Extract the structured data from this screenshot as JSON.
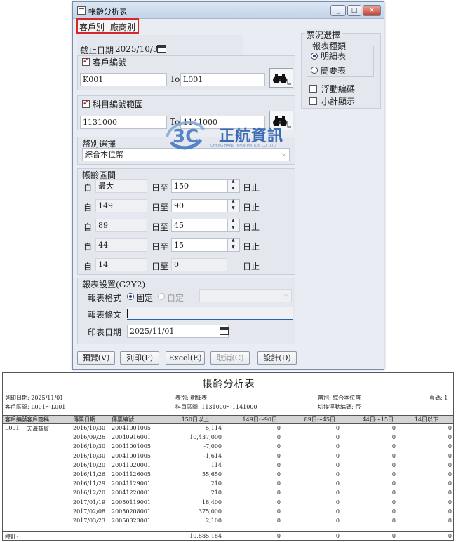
{
  "window": {
    "title": "帳齡分析表",
    "min": "_",
    "max": "□",
    "close": "×"
  },
  "tabs": [
    "客戶別",
    "廠商別"
  ],
  "cutoff": {
    "label": "截止日期",
    "value": "2025/10/31"
  },
  "customer": {
    "label": "客戶編號",
    "from": "K001",
    "to_label": "To",
    "to": "L001"
  },
  "account": {
    "label": "科目編號範圍",
    "from": "1131000",
    "to_label": "To",
    "to": "1141000"
  },
  "currency": {
    "label": "幣別選擇",
    "value": "綜合本位幣"
  },
  "aging": {
    "label": "帳齡區間",
    "prefix": "自",
    "mid": "日至",
    "suffix": "日止",
    "rows": [
      {
        "from": "最大",
        "to": "150"
      },
      {
        "from": "149",
        "to": "90"
      },
      {
        "from": "89",
        "to": "45"
      },
      {
        "from": "44",
        "to": "15"
      },
      {
        "from": "14",
        "to": "0"
      }
    ]
  },
  "voucher": {
    "label": "票況選擇",
    "type_label": "報表種類",
    "opt_detail": "明細表",
    "opt_summary": "簡要表",
    "float_code": "浮動編碼",
    "subtotal": "小計顯示"
  },
  "report_settings": {
    "label": "報表設置(G2Y2)",
    "format_label": "報表格式",
    "fixed": "固定",
    "custom": "自定",
    "text_label": "報表條文",
    "print_date_label": "印表日期",
    "print_date": "2025/11/01"
  },
  "buttons": {
    "preview": "預覽(V)",
    "print": "列印(P)",
    "excel": "Excel(E)",
    "cancel": "取消(C)",
    "design": "設計(D)"
  },
  "watermark": {
    "brand": "正航資訊",
    "sub": "CHENG HANG INFORMATION CO., LTD"
  },
  "report": {
    "title": "帳齡分析表",
    "print_date": "列印日期: 2025/11/01",
    "customer_range": "客戶區間: L001～L001",
    "table_type": "表別: 明細表",
    "account_range": "科目區間: 1131000～1141000",
    "currency": "幣別: 綜合本位幣",
    "float_code": "切換浮動編碼: 否",
    "page": "頁碼: 1",
    "headers": [
      "客戶編號",
      "客戶簡稱",
      "傳票日期",
      "傳票編號",
      "150日以上",
      "149日～90日",
      "89日～45日",
      "44日～15日",
      "14日以下"
    ],
    "customer_id": "L001",
    "customer_name": "天海商貿",
    "rows": [
      [
        "2016/10/30",
        "20041001005",
        "5,114",
        "0",
        "0",
        "0",
        "0"
      ],
      [
        "2016/09/26",
        "20040916001",
        "10,437,000",
        "0",
        "0",
        "0",
        "0"
      ],
      [
        "2016/10/30",
        "20041001005",
        "-7,000",
        "0",
        "0",
        "0",
        "0"
      ],
      [
        "2016/10/30",
        "20041001005",
        "-1,614",
        "0",
        "0",
        "0",
        "0"
      ],
      [
        "2016/10/20",
        "20041020001",
        "114",
        "0",
        "0",
        "0",
        "0"
      ],
      [
        "2016/11/26",
        "20041126005",
        "55,650",
        "0",
        "0",
        "0",
        "0"
      ],
      [
        "2016/11/29",
        "20041129001",
        "210",
        "0",
        "0",
        "0",
        "0"
      ],
      [
        "2016/12/20",
        "20041220001",
        "210",
        "0",
        "0",
        "0",
        "0"
      ],
      [
        "2017/01/19",
        "20050119001",
        "18,400",
        "0",
        "0",
        "0",
        "0"
      ],
      [
        "2017/02/08",
        "20050208001",
        "375,000",
        "0",
        "0",
        "0",
        "0"
      ],
      [
        "2017/03/23",
        "20050323001",
        "2,100",
        "0",
        "0",
        "0",
        "0"
      ]
    ],
    "total_label": "總計:",
    "totals": [
      "10,885,184",
      "0",
      "0",
      "0",
      "0"
    ]
  }
}
